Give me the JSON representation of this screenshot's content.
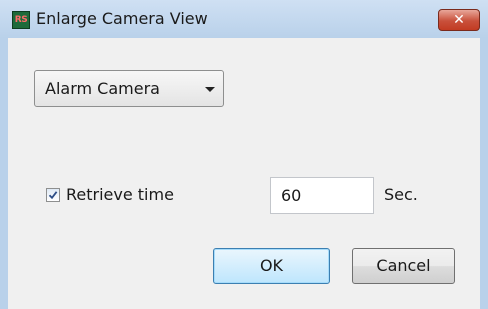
{
  "window": {
    "title": "Enlarge Camera View",
    "app_icon_text": "RS",
    "close_label": "✕"
  },
  "camera_select": {
    "selected": "Alarm Camera"
  },
  "retrieve": {
    "checked": true,
    "label": "Retrieve time",
    "value": "60",
    "unit": "Sec."
  },
  "buttons": {
    "ok": "OK",
    "cancel": "Cancel"
  },
  "colors": {
    "titlebar": "#b9d1ea",
    "close_button": "#c9503b",
    "ok_border": "#3c7fb1"
  }
}
